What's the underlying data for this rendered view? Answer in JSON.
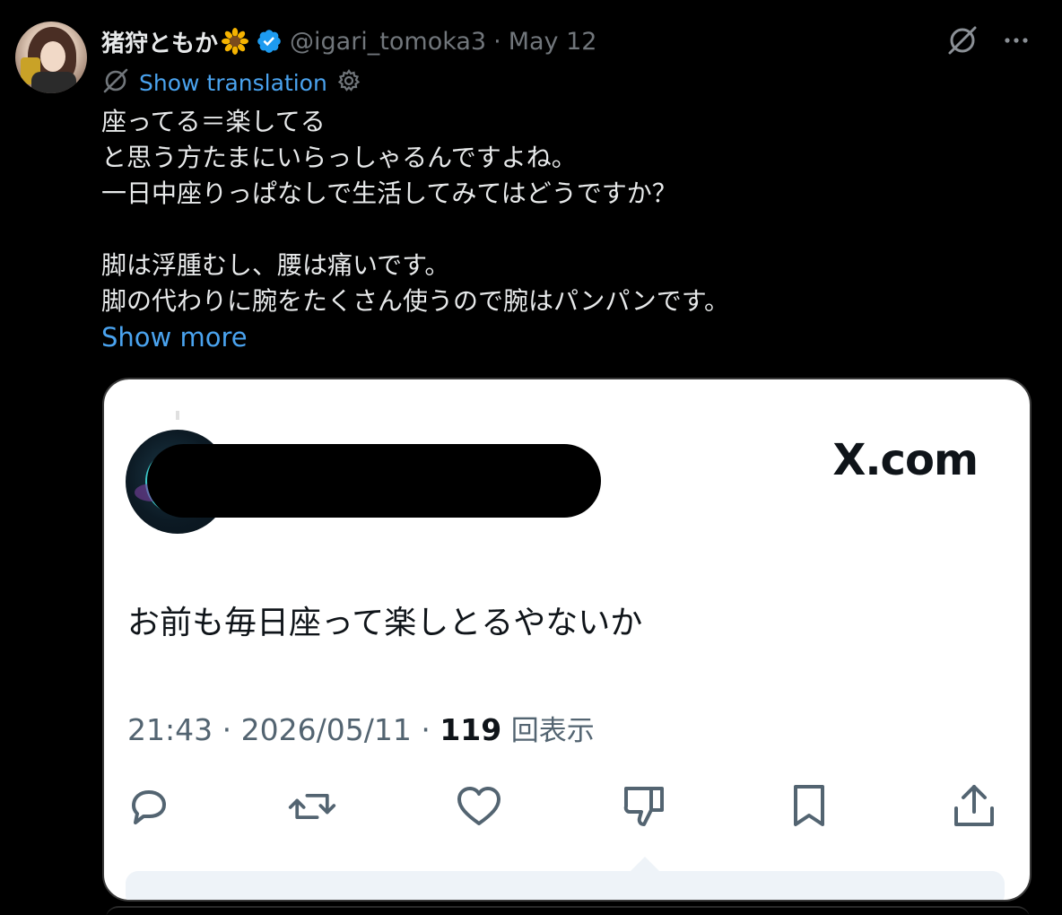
{
  "tweet": {
    "author_name": "猪狩ともか",
    "handle": "@igari_tomoka3",
    "separator": "·",
    "date": "May 12",
    "translate_label": "Show translation",
    "text_lines": [
      "座ってる＝楽してる",
      "と思う方たまにいらっしゃるんですよね。",
      "一日中座りっぱなしで生活してみてはどうですか？",
      "",
      "脚は浮腫むし、腰は痛いです。",
      "脚の代わりに腕をたくさん使うので腕はパンパンです。"
    ],
    "show_more": "Show more"
  },
  "embed": {
    "site": "X.com",
    "text": "お前も毎日座って楽しとるやないか",
    "time": "21:43",
    "date": "2026/05/11",
    "separator": "·",
    "views_count": "119",
    "views_label": "回表示"
  },
  "icons": {
    "verified": "verified-badge-icon",
    "sunflower": "sunflower-emoji-icon",
    "grok": "grok-icon",
    "more": "more-icon",
    "translate": "translate-icon",
    "settings": "settings-icon",
    "reply": "reply-icon",
    "retweet": "retweet-icon",
    "like": "like-icon",
    "dislike": "dislike-icon",
    "bookmark": "bookmark-icon",
    "share": "share-icon"
  },
  "colors": {
    "background": "#000000",
    "link": "#4aa3ef",
    "verified": "#1d9bf0",
    "muted": "#71767b"
  }
}
